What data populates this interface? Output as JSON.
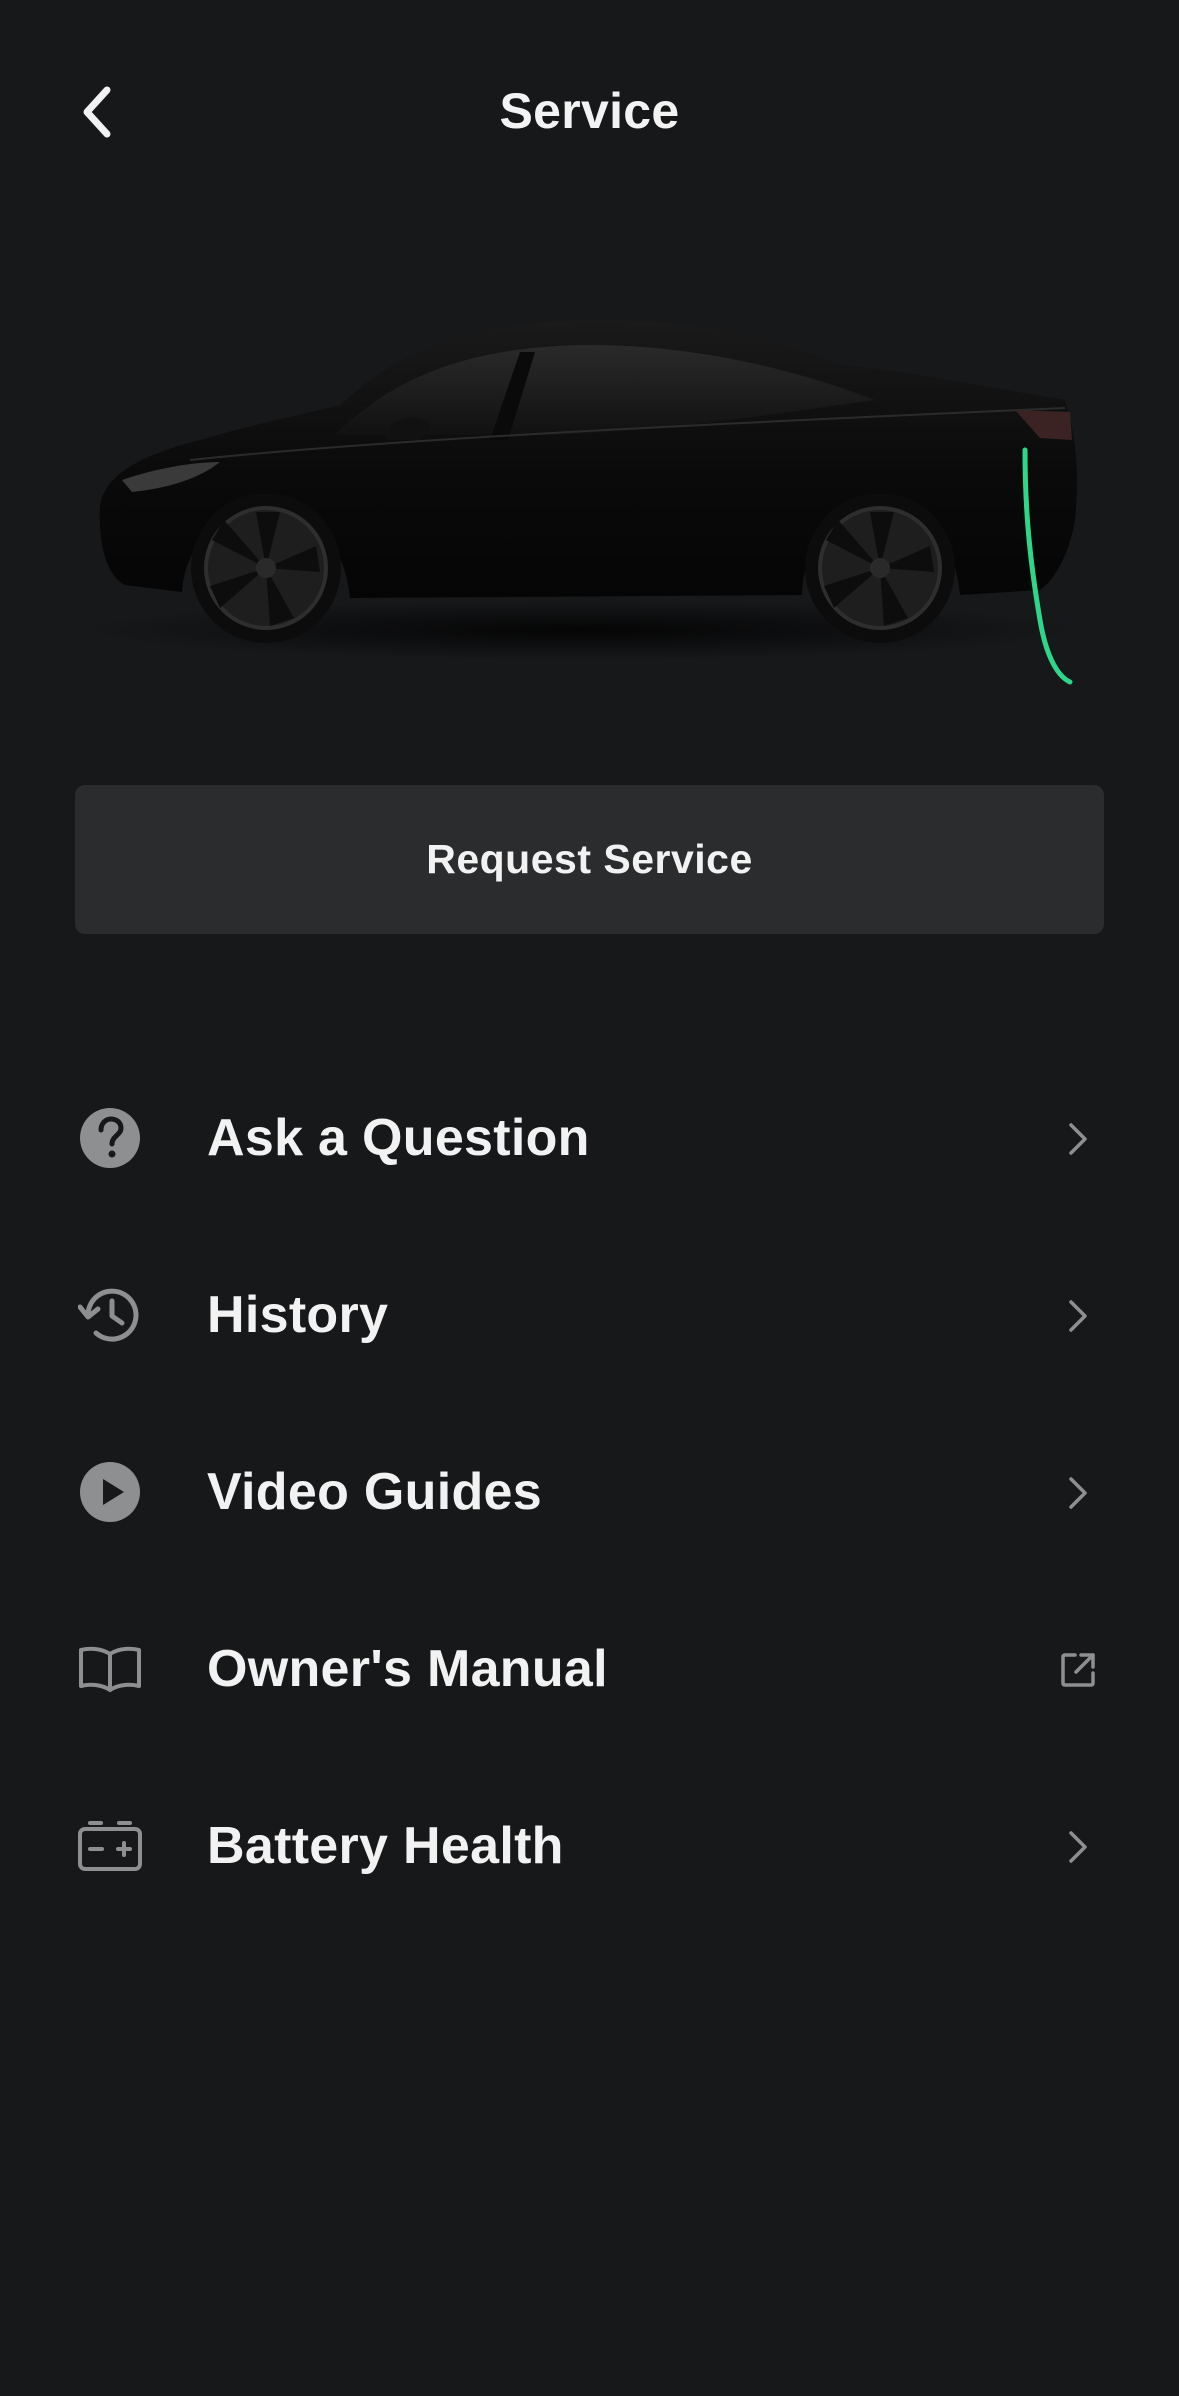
{
  "header": {
    "title": "Service",
    "back_icon": "chevron-left-icon"
  },
  "hero": {
    "image": "car-side-charging",
    "charge_cable_color": "#2fd68a"
  },
  "request_button": {
    "label": "Request Service"
  },
  "menu": {
    "items": [
      {
        "label": "Ask a Question",
        "icon": "question-circle-icon",
        "trail": "chevron-right-icon"
      },
      {
        "label": "History",
        "icon": "history-clock-icon",
        "trail": "chevron-right-icon"
      },
      {
        "label": "Video Guides",
        "icon": "play-circle-icon",
        "trail": "chevron-right-icon"
      },
      {
        "label": "Owner's Manual",
        "icon": "book-open-icon",
        "trail": "external-link-icon"
      },
      {
        "label": "Battery Health",
        "icon": "battery-icon",
        "trail": "chevron-right-icon"
      }
    ]
  },
  "colors": {
    "background": "#17181a",
    "button": "#2b2c2e",
    "icon": "#8e8f91",
    "text": "#f2f2f2"
  }
}
